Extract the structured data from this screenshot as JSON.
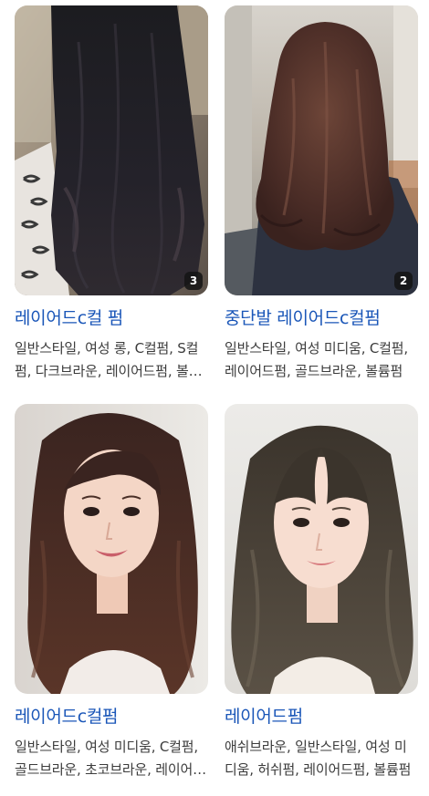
{
  "results": [
    {
      "title": "레이어드c컬 펌",
      "description": "일반스타일, 여성 롱, C컬펌, S컬펌, 다크브라운, 레이어드펌, 볼륨펌",
      "image_count": "3",
      "image_alt": "long dark wavy layered hair, back view"
    },
    {
      "title": "중단발 레이어드c컬펌",
      "description": "일반스타일, 여성 미디움, C컬펌, 레이어드펌, 골드브라운, 볼륨펌",
      "image_count": "2",
      "image_alt": "medium length brown layered c-curl hair, back view"
    },
    {
      "title": "레이어드c컬펌",
      "description": "일반스타일, 여성 미디움, C컬펌, 골드브라운, 초코브라운, 레이어드펌",
      "image_count": "",
      "image_alt": "woman with long brown layered hair"
    },
    {
      "title": "레이어드펌",
      "description": "애쉬브라운, 일반스타일, 여성 미디움, 허쉬펌, 레이어드펌, 볼륨펌",
      "image_count": "",
      "image_alt": "woman with ash brown layered wavy hair"
    }
  ]
}
